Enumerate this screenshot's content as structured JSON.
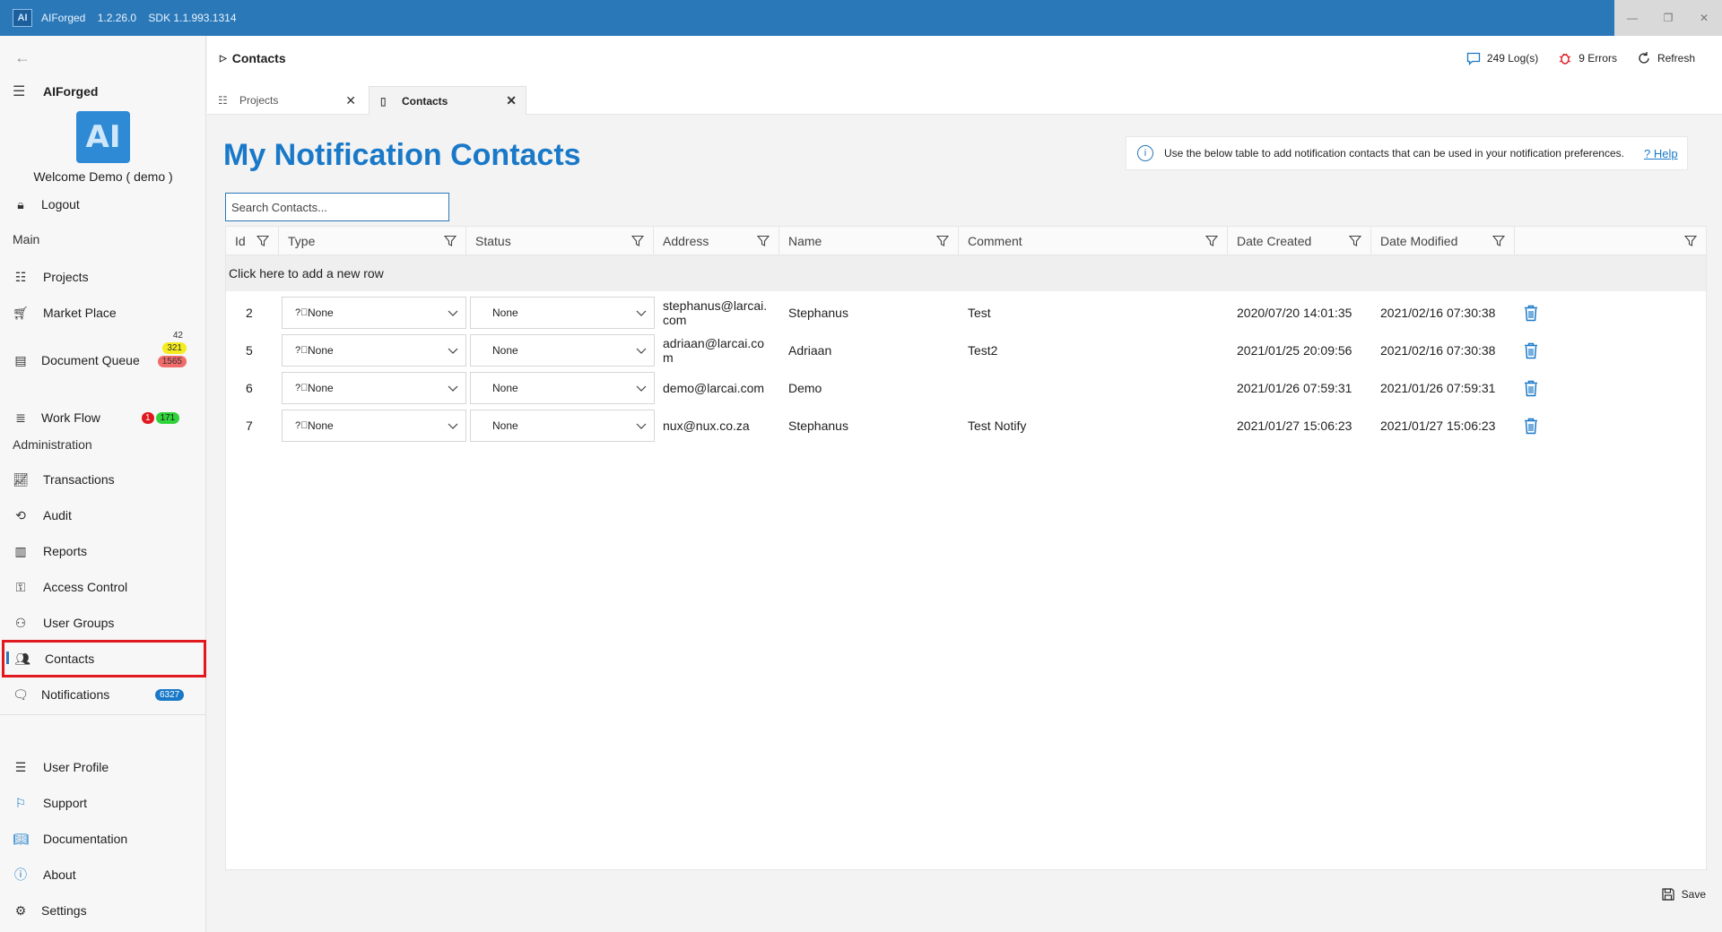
{
  "titlebar": {
    "logo_text": "AI",
    "app_name": "AIForged",
    "version": "1.2.26.0",
    "sdk": "SDK 1.1.993.1314",
    "minimize": "—",
    "maximize": "❐",
    "close": "✕"
  },
  "sidebar": {
    "brand": "AIForged",
    "avatar_text": "AI",
    "welcome": "Welcome  Demo  ( demo )",
    "logout": "Logout",
    "section_main": "Main",
    "projects": "Projects",
    "market_place": "Market Place",
    "document_queue": "Document Queue",
    "doc_queue_badges": [
      "42",
      "321",
      "1565"
    ],
    "work_flow": "Work Flow",
    "work_flow_badges": [
      "1",
      "171"
    ],
    "section_admin": "Administration",
    "transactions": "Transactions",
    "audit": "Audit",
    "reports": "Reports",
    "access_control": "Access Control",
    "user_groups": "User Groups",
    "contacts": "Contacts",
    "notifications": "Notifications",
    "notifications_badge": "6327",
    "user_profile": "User Profile",
    "support": "Support",
    "documentation": "Documentation",
    "about": "About",
    "settings": "Settings"
  },
  "topbar": {
    "breadcrumb": "Contacts",
    "logs": "249 Log(s)",
    "errors": "9 Errors",
    "refresh": "Refresh"
  },
  "tabs": [
    {
      "label": "Projects"
    },
    {
      "label": "Contacts"
    }
  ],
  "page": {
    "title": "My Notification Contacts",
    "info_text": "Use the below table to add notification contacts that can be used in your notification preferences.",
    "help": "? Help",
    "search_placeholder": "Search Contacts...",
    "add_row": "Click here to add a new row",
    "save": "Save"
  },
  "table": {
    "headers": [
      "Id",
      "Type",
      "Status",
      "Address",
      "Name",
      "Comment",
      "Date Created",
      "Date Modified"
    ],
    "rows": [
      {
        "id": "2",
        "type": "None",
        "status": "None",
        "address": "stephanus@larcai.com",
        "name": "Stephanus",
        "comment": "Test",
        "created": "2020/07/20 14:01:35",
        "modified": "2021/02/16 07:30:38"
      },
      {
        "id": "5",
        "type": "None",
        "status": "None",
        "address": "adriaan@larcai.com",
        "name": "Adriaan",
        "comment": "Test2",
        "created": "2021/01/25 20:09:56",
        "modified": "2021/02/16 07:30:38"
      },
      {
        "id": "6",
        "type": "None",
        "status": "None",
        "address": "demo@larcai.com",
        "name": "Demo",
        "comment": "",
        "created": "2021/01/26 07:59:31",
        "modified": "2021/01/26 07:59:31"
      },
      {
        "id": "7",
        "type": "None",
        "status": "None",
        "address": "nux@nux.co.za",
        "name": "Stephanus",
        "comment": "Test Notify",
        "created": "2021/01/27 15:06:23",
        "modified": "2021/01/27 15:06:23"
      }
    ]
  },
  "colors": {
    "accent": "#1979c8",
    "titlebar": "#2b78b9",
    "active_outline": "#e0191f",
    "badge_yellow": "#f4ec1f",
    "badge_red": "#f26b6b",
    "badge_green": "#2fd33a",
    "badge_blue": "#1979c8"
  },
  "icons": {
    "back": "back-arrow-icon",
    "menu": "hamburger-icon",
    "logs": "chat-icon",
    "errors": "bug-icon",
    "refresh": "refresh-icon",
    "filter": "funnel-icon",
    "delete": "trash-icon",
    "save": "floppy-icon"
  }
}
